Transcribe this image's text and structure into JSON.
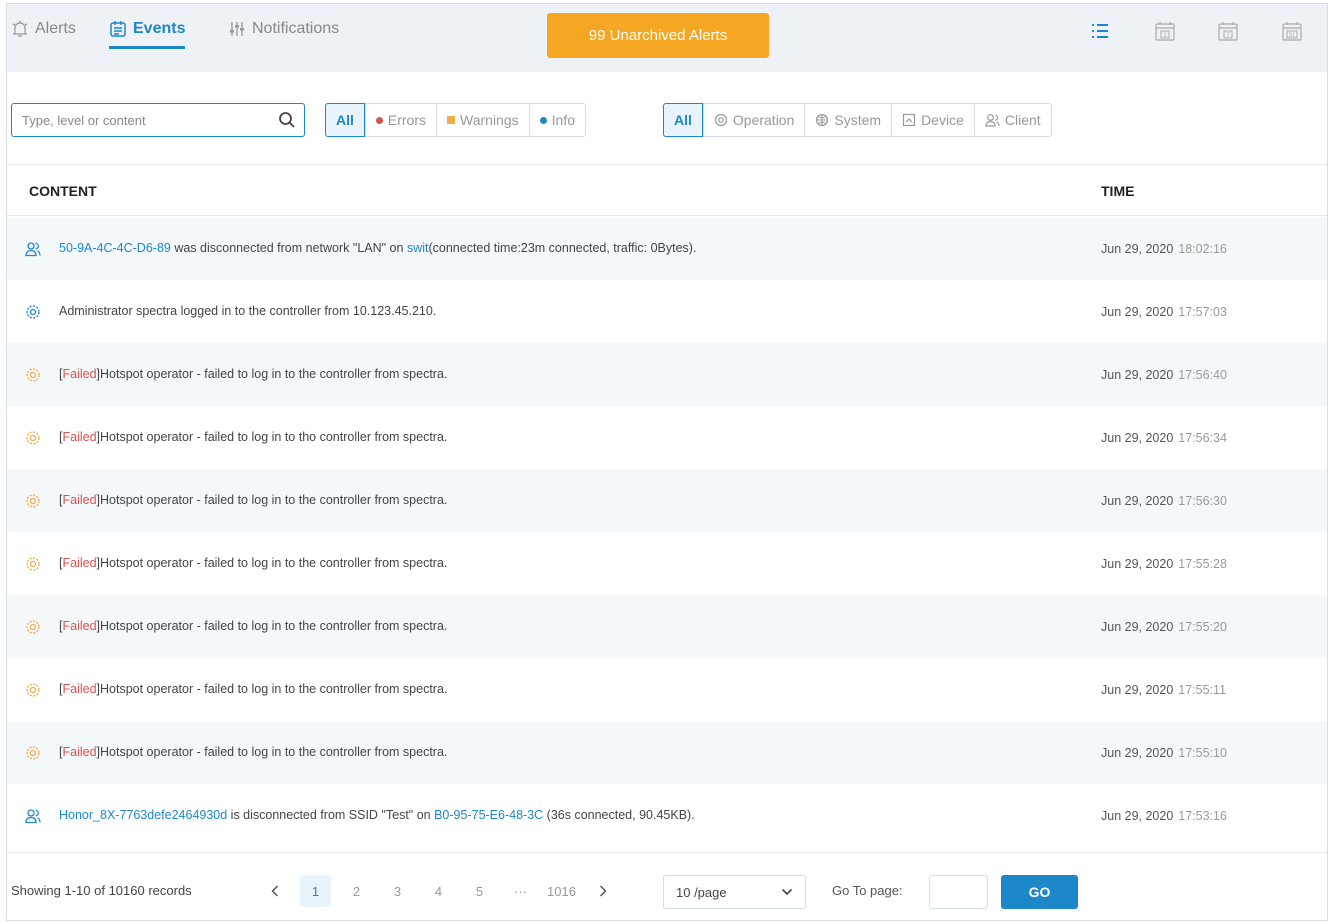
{
  "tabs": [
    {
      "label": "Alerts",
      "icon": "alert-icon"
    },
    {
      "label": "Events",
      "icon": "events-icon"
    },
    {
      "label": "Notifications",
      "icon": "notifications-icon"
    }
  ],
  "alerts_button": "99 Unarchived Alerts",
  "calendar_icons": [
    "1",
    "7",
    "31"
  ],
  "search": {
    "placeholder": "Type, level or content"
  },
  "level_filter": {
    "all": "All",
    "errors": "Errors",
    "warnings": "Warnings",
    "info": "Info"
  },
  "type_filter": {
    "all": "All",
    "operation": "Operation",
    "system": "System",
    "device": "Device",
    "client": "Client"
  },
  "table": {
    "headers": {
      "content": "CONTENT",
      "time": "TIME"
    },
    "rows": [
      {
        "icon": "client-icon",
        "parts": [
          {
            "t": "50-9A-4C-4C-D6-89",
            "c": "link"
          },
          {
            "t": " was disconnected from network \"LAN\" on ",
            "c": ""
          },
          {
            "t": "swit",
            "c": "link"
          },
          {
            "t": "(connected time:23m connected, traffic: 0Bytes).",
            "c": ""
          }
        ],
        "date": "Jun 29, 2020",
        "clock": "18:02:16"
      },
      {
        "icon": "operation-icon",
        "parts": [
          {
            "t": "Administrator spectra logged in to the controller from 10.123.45.210.",
            "c": ""
          }
        ],
        "date": "Jun 29, 2020",
        "clock": "17:57:03"
      },
      {
        "icon": "warning-icon",
        "parts": [
          {
            "t": "[",
            "c": ""
          },
          {
            "t": "Failed",
            "c": "failed"
          },
          {
            "t": "]Hotspot operator - failed to log in to the controller from spectra.",
            "c": ""
          }
        ],
        "date": "Jun 29, 2020",
        "clock": "17:56:40"
      },
      {
        "icon": "warning-icon",
        "parts": [
          {
            "t": "[",
            "c": ""
          },
          {
            "t": "Failed",
            "c": "failed"
          },
          {
            "t": "]Hotspot operator - failed to log in to tho controller from spectra.",
            "c": ""
          }
        ],
        "date": "Jun 29, 2020",
        "clock": "17:56:34"
      },
      {
        "icon": "warning-icon",
        "parts": [
          {
            "t": "[",
            "c": ""
          },
          {
            "t": "Failed",
            "c": "failed"
          },
          {
            "t": "]Hotspot operator - failed to log in to the controller from spectra.",
            "c": ""
          }
        ],
        "date": "Jun 29, 2020",
        "clock": "17:56:30"
      },
      {
        "icon": "warning-icon",
        "parts": [
          {
            "t": "[",
            "c": ""
          },
          {
            "t": "Failed",
            "c": "failed"
          },
          {
            "t": "]Hotspot operator - failed to log in to the controller from spectra.",
            "c": ""
          }
        ],
        "date": "Jun 29, 2020",
        "clock": "17:55:28"
      },
      {
        "icon": "warning-icon",
        "parts": [
          {
            "t": "[",
            "c": ""
          },
          {
            "t": "Failed",
            "c": "failed"
          },
          {
            "t": "]Hotspot operator - failed to log in to the controller from spectra.",
            "c": ""
          }
        ],
        "date": "Jun 29, 2020",
        "clock": "17:55:20"
      },
      {
        "icon": "warning-icon",
        "parts": [
          {
            "t": "[",
            "c": ""
          },
          {
            "t": "Failed",
            "c": "failed"
          },
          {
            "t": "]Hotspot operator - failed to log in to the controller from spectra.",
            "c": ""
          }
        ],
        "date": "Jun 29, 2020",
        "clock": "17:55:11"
      },
      {
        "icon": "warning-icon",
        "parts": [
          {
            "t": "[",
            "c": ""
          },
          {
            "t": "Failed",
            "c": "failed"
          },
          {
            "t": "]Hotspot operator - failed to log in to the controller from spectra.",
            "c": ""
          }
        ],
        "date": "Jun 29, 2020",
        "clock": "17:55:10"
      },
      {
        "icon": "client-icon",
        "parts": [
          {
            "t": "Honor_8X-7763defe2464930d",
            "c": "link"
          },
          {
            "t": " is disconnected from SSID \"Test\" on ",
            "c": ""
          },
          {
            "t": "B0-95-75-E6-48-3C",
            "c": "link"
          },
          {
            "t": " (36s connected, 90.45KB).",
            "c": ""
          }
        ],
        "date": "Jun 29, 2020",
        "clock": "17:53:16"
      }
    ]
  },
  "footer": {
    "records": "Showing 1-10 of 10160 records",
    "pages": [
      "1",
      "2",
      "3",
      "4",
      "5",
      "···",
      "1016"
    ],
    "current_page": "1",
    "per_page": "10 /page",
    "goto_label": "Go To page:",
    "goto_value": "",
    "go_button": "GO"
  },
  "colors": {
    "accent": "#1d88c9",
    "alerts_button": "#f5a623",
    "errors": "#d9534f",
    "warnings": "#f0ad4e",
    "info": "#1d88c9"
  }
}
